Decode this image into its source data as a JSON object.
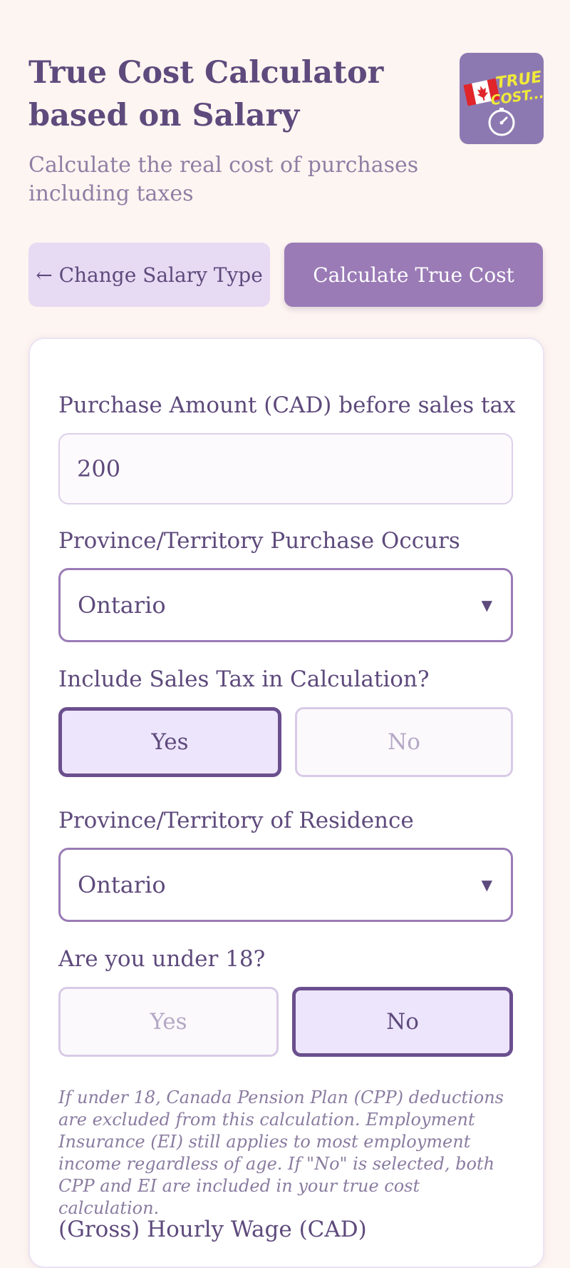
{
  "header": {
    "title": "True Cost Calculator based on Salary",
    "subtitle": "Calculate the real cost of purchases including taxes",
    "app_icon": {
      "name": "true-cost-app-icon",
      "text_line1": "TRUE",
      "text_line2": "COST...",
      "bg_color": "#8d79b1"
    }
  },
  "buttons": {
    "change_salary_type": "← Change Salary Type",
    "calculate": "Calculate True Cost"
  },
  "form": {
    "purchase_amount": {
      "label": "Purchase Amount (CAD) before sales tax",
      "value": "200"
    },
    "purchase_province": {
      "label": "Province/Territory Purchase Occurs",
      "value": "Ontario"
    },
    "include_sales_tax": {
      "label": "Include Sales Tax in Calculation?",
      "yes": "Yes",
      "no": "No",
      "selected": "Yes"
    },
    "residence_province": {
      "label": "Province/Territory of Residence",
      "value": "Ontario"
    },
    "under_18": {
      "label": "Are you under 18?",
      "yes": "Yes",
      "no": "No",
      "selected": "No"
    },
    "note": "If under 18, Canada Pension Plan (CPP) deductions are excluded from this calculation. Employment Insurance (EI) still applies to most employment income regardless of age. If \"No\" is selected, both CPP and EI are included in your true cost calculation.",
    "hourly_wage": {
      "label": "(Gross) Hourly Wage (CAD)"
    }
  },
  "colors": {
    "background": "#fdf5f1",
    "primary": "#9a7bb6",
    "text": "#5e4a7c",
    "selected_border": "#6a4f8e"
  }
}
